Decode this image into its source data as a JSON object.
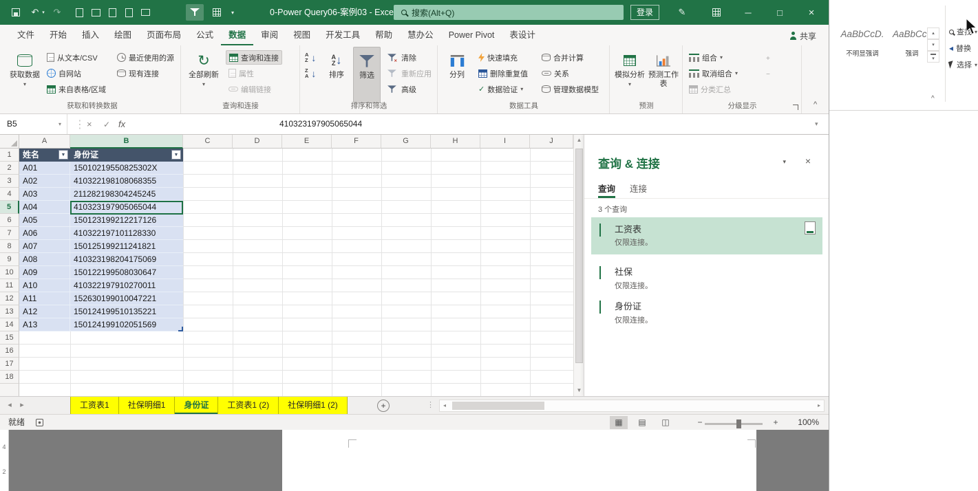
{
  "titlebar": {
    "title": "0-Power Query06-案例03 - Excel",
    "search": "搜索(Alt+Q)",
    "sign_in": "登录"
  },
  "tabs": {
    "items": [
      "文件",
      "开始",
      "插入",
      "绘图",
      "页面布局",
      "公式",
      "数据",
      "审阅",
      "视图",
      "开发工具",
      "帮助",
      "慧办公",
      "Power Pivot",
      "表设计"
    ],
    "share": "共享"
  },
  "ribbon": {
    "g1": {
      "label": "获取和转换数据",
      "get_data": "获取数据",
      "from_text": "从文本/CSV",
      "from_web": "自网站",
      "from_table": "来自表格/区域",
      "recent": "最近使用的源",
      "existing": "现有连接"
    },
    "g2": {
      "label": "查询和连接",
      "refresh_all": "全部刷新",
      "queries": "查询和连接",
      "properties": "属性",
      "edit_links": "编辑链接"
    },
    "g3": {
      "label": "排序和筛选",
      "sort": "排序",
      "filter": "筛选",
      "clear": "清除",
      "reapply": "重新应用",
      "advanced": "高级"
    },
    "g4": {
      "label": "数据工具",
      "text_to_columns": "分列",
      "flash_fill": "快速填充",
      "remove_duplicates": "删除重复值",
      "data_validation": "数据验证",
      "consolidate": "合并计算",
      "relationships": "关系",
      "manage_model": "管理数据模型"
    },
    "g5": {
      "label": "预测",
      "what_if": "模拟分析",
      "forecast": "预测工作表"
    },
    "g6": {
      "label": "分级显示",
      "group": "组合",
      "ungroup": "取消组合",
      "subtotal": "分类汇总"
    }
  },
  "formula_bar": {
    "name_box": "B5",
    "fx": "fx",
    "value": "410323197905065044"
  },
  "grid": {
    "cols": [
      "A",
      "B",
      "C",
      "D",
      "E",
      "F",
      "G",
      "H",
      "I",
      "J"
    ],
    "rows": [
      "1",
      "2",
      "3",
      "4",
      "5",
      "6",
      "7",
      "8",
      "9",
      "10",
      "11",
      "12",
      "13",
      "14",
      "15",
      "16",
      "17",
      "18"
    ]
  },
  "table": {
    "h_name": "姓名",
    "h_id": "身份证",
    "rows": [
      {
        "n": "A01",
        "i": "15010219550825302X"
      },
      {
        "n": "A02",
        "i": "410322198108068355"
      },
      {
        "n": "A03",
        "i": "211282198304245245"
      },
      {
        "n": "A04",
        "i": "410323197905065044"
      },
      {
        "n": "A05",
        "i": "150123199212217126"
      },
      {
        "n": "A06",
        "i": "410322197101128330"
      },
      {
        "n": "A07",
        "i": "150125199211241821"
      },
      {
        "n": "A08",
        "i": "410323198204175069"
      },
      {
        "n": "A09",
        "i": "150122199508030647"
      },
      {
        "n": "A10",
        "i": "410322197910270011"
      },
      {
        "n": "A11",
        "i": "152630199010047221"
      },
      {
        "n": "A12",
        "i": "150124199510135221"
      },
      {
        "n": "A13",
        "i": "150124199102051569"
      }
    ]
  },
  "query_pane": {
    "title": "查询 & 连接",
    "tab_queries": "查询",
    "tab_connections": "连接",
    "count": "3 个查询",
    "items": [
      {
        "name": "工资表",
        "sub": "仅限连接。"
      },
      {
        "name": "社保",
        "sub": "仅限连接。"
      },
      {
        "name": "身份证",
        "sub": "仅限连接。"
      }
    ]
  },
  "sheet_tabs": [
    "工资表1",
    "社保明细1",
    "身份证",
    "工资表1 (2)",
    "社保明细1 (2)"
  ],
  "status_bar": {
    "ready": "就绪",
    "zoom": "100%"
  },
  "word_panel": {
    "style1": "AaBbCcD.",
    "style1_label": "不明显强调",
    "style2": "AaBbCcD.",
    "style2_label": "强调",
    "find": "查找",
    "replace": "替换",
    "select": "选择"
  },
  "ruler": {
    "m1": "4",
    "m2": "2"
  },
  "colors": {
    "excel_green": "#217346",
    "table_header": "#44546A",
    "table_fill": "#D9E1F2",
    "sheet_tab_fill": "#FFFF00",
    "selection": "#C6E2D2"
  },
  "icons": {
    "chev": "▾",
    "up": "▴",
    "left": "◂",
    "right": "▸",
    "down_arrow": "↓",
    "close": "×",
    "min": "─",
    "max": "□",
    "undo": "↶",
    "redo": "↷",
    "refresh": "↻",
    "enter": "✓",
    "cancel": "×",
    "scroll_up": "▲",
    "scroll_down": "▼",
    "dots": "⋮",
    "plus": "+",
    "minus": "−",
    "a": "A",
    "z": "Z",
    "pen": "✎",
    "caret": "^",
    "view1": "▦",
    "view2": "▤",
    "view3": "◫",
    "filter_arrow": "▼"
  }
}
